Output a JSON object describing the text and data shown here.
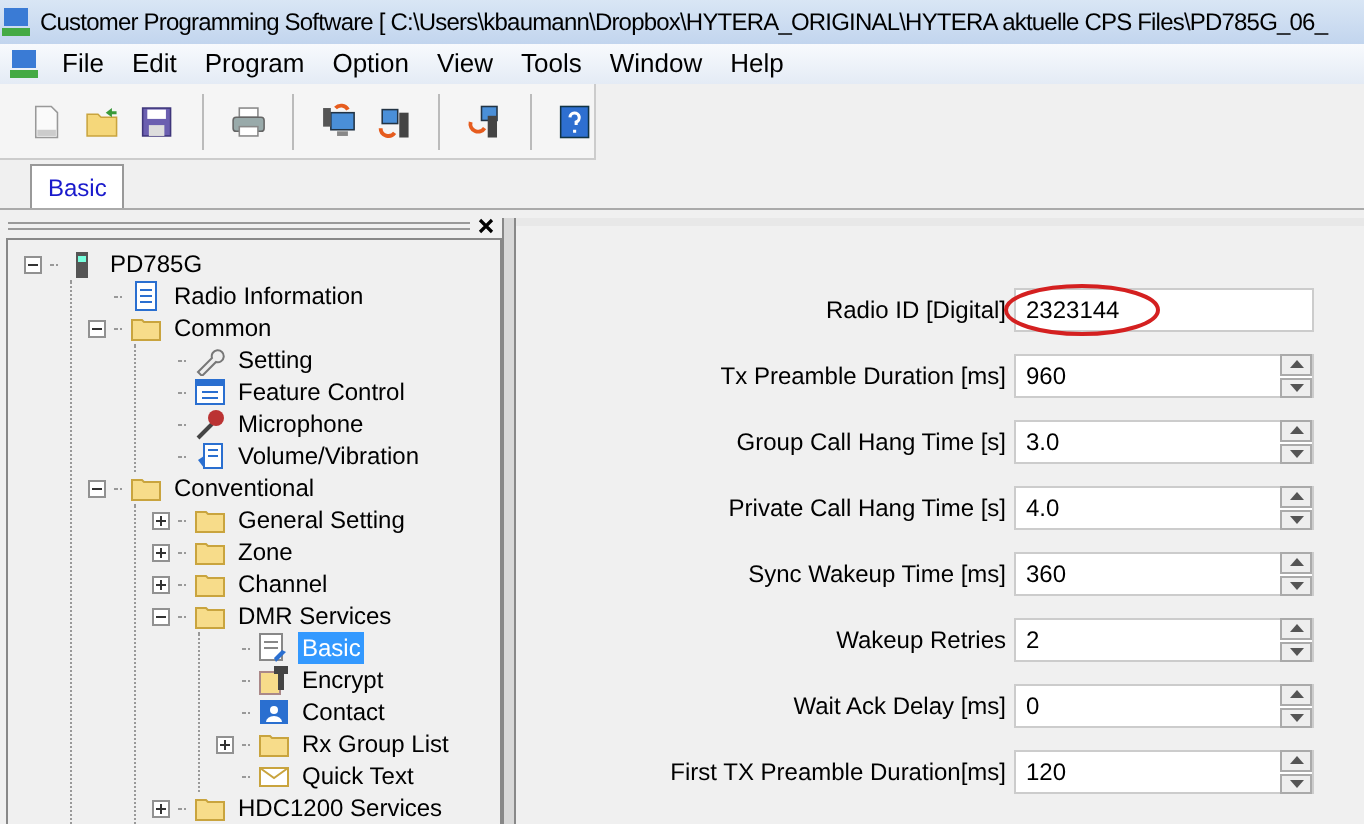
{
  "window": {
    "title": "Customer Programming Software [ C:\\Users\\kbaumann\\Dropbox\\HYTERA_ORIGINAL\\HYTERA aktuelle CPS Files\\PD785G_06_"
  },
  "menu": [
    "File",
    "Edit",
    "Program",
    "Option",
    "View",
    "Tools",
    "Window",
    "Help"
  ],
  "toolbar": [
    {
      "kind": "new"
    },
    {
      "kind": "open"
    },
    {
      "kind": "save"
    },
    {
      "kind": "sep"
    },
    {
      "kind": "print"
    },
    {
      "kind": "sep"
    },
    {
      "kind": "read"
    },
    {
      "kind": "write"
    },
    {
      "kind": "sep"
    },
    {
      "kind": "clone"
    },
    {
      "kind": "sep"
    },
    {
      "kind": "help"
    }
  ],
  "tabs": [
    {
      "label": "Basic",
      "selected": true
    }
  ],
  "tree": [
    {
      "label": "PD785G",
      "kind": "radio",
      "expanded": true,
      "selected": false,
      "children": [
        {
          "label": "Radio Information",
          "kind": "document",
          "selected": false
        },
        {
          "label": "Common",
          "kind": "folder",
          "expanded": true,
          "selected": false,
          "children": [
            {
              "label": "Setting",
              "kind": "wrench",
              "selected": false
            },
            {
              "label": "Feature Control",
              "kind": "list",
              "selected": false
            },
            {
              "label": "Microphone",
              "kind": "microphone",
              "selected": false
            },
            {
              "label": "Volume/Vibration",
              "kind": "speaker",
              "selected": false
            }
          ]
        },
        {
          "label": "Conventional",
          "kind": "folder",
          "expanded": true,
          "selected": false,
          "children": [
            {
              "label": "General Setting",
              "kind": "folder",
              "expanded": false,
              "selected": false
            },
            {
              "label": "Zone",
              "kind": "folder",
              "expanded": false,
              "selected": false
            },
            {
              "label": "Channel",
              "kind": "folder",
              "expanded": false,
              "selected": false
            },
            {
              "label": "DMR Services",
              "kind": "folder",
              "expanded": true,
              "selected": false,
              "children": [
                {
                  "label": "Basic",
                  "kind": "edit",
                  "selected": true
                },
                {
                  "label": "Encrypt",
                  "kind": "key",
                  "selected": false
                },
                {
                  "label": "Contact",
                  "kind": "contact",
                  "selected": false
                },
                {
                  "label": "Rx Group List",
                  "kind": "folder",
                  "expanded": false,
                  "selected": false
                },
                {
                  "label": "Quick Text",
                  "kind": "mail",
                  "selected": false
                }
              ]
            },
            {
              "label": "HDC1200 Services",
              "kind": "folder",
              "expanded": false,
              "selected": false
            }
          ]
        }
      ]
    }
  ],
  "fields": [
    {
      "label": "Radio ID [Digital]",
      "value": "2323144",
      "kind": "text"
    },
    {
      "label": "Tx Preamble Duration [ms]",
      "value": "960",
      "kind": "spin"
    },
    {
      "label": "Group Call Hang Time [s]",
      "value": "3.0",
      "kind": "spin"
    },
    {
      "label": "Private Call Hang Time [s]",
      "value": "4.0",
      "kind": "spin"
    },
    {
      "label": "Sync Wakeup Time [ms]",
      "value": "360",
      "kind": "spin"
    },
    {
      "label": "Wakeup Retries",
      "value": "2",
      "kind": "spin"
    },
    {
      "label": "Wait Ack Delay [ms]",
      "value": "0",
      "kind": "spin"
    },
    {
      "label": "First TX Preamble Duration[ms]",
      "value": "120",
      "kind": "spin"
    }
  ]
}
